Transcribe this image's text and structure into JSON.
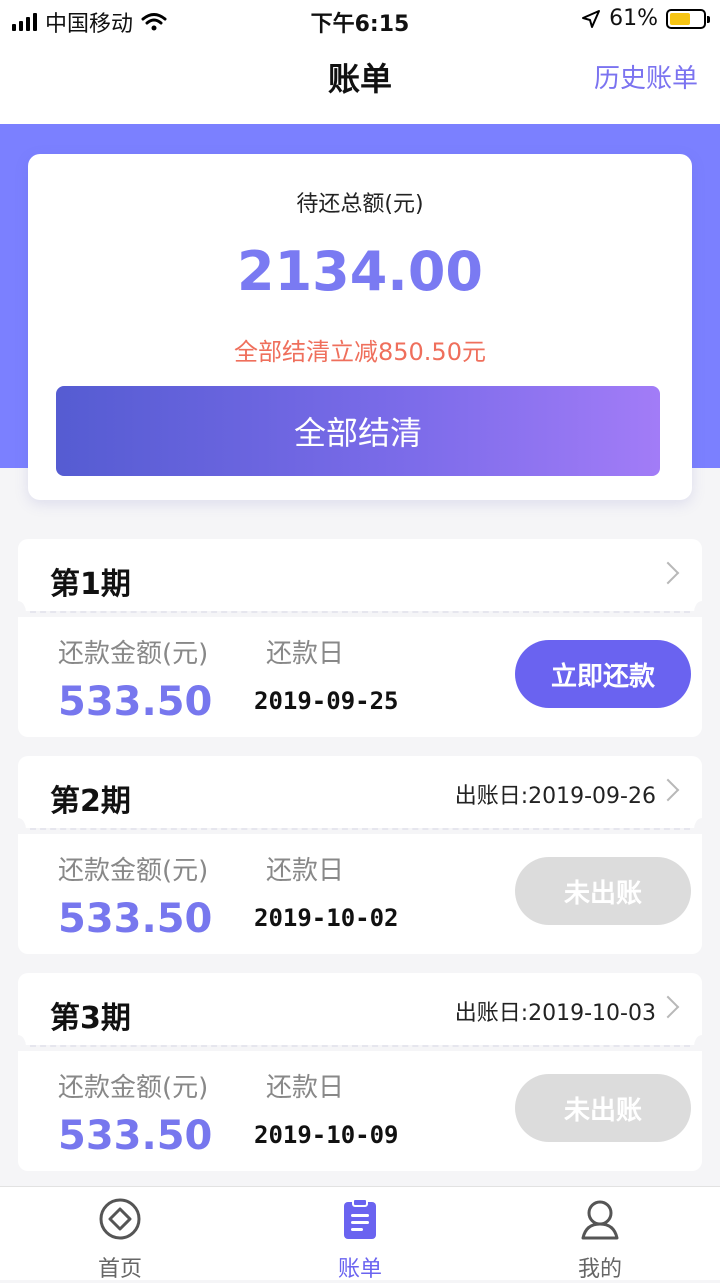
{
  "status_bar": {
    "carrier": "中国移动",
    "time": "下午6:15",
    "battery_percent": "61%",
    "battery_level": 0.61,
    "icons": [
      "signal-icon",
      "wifi-icon",
      "location-arrow-icon",
      "battery-icon"
    ]
  },
  "nav": {
    "title": "账单",
    "history_link": "历史账单"
  },
  "summary": {
    "label": "待还总额(元)",
    "amount": "2134.00",
    "discount_text": "全部结清立减850.50元",
    "settle_button": "全部结清"
  },
  "bills": [
    {
      "period": "第1期",
      "billing_date": "",
      "amount_label": "还款金额(元)",
      "due_label": "还款日",
      "amount": "533.50",
      "due_date": "2019-09-25",
      "button": "立即还款",
      "button_enabled": true
    },
    {
      "period": "第2期",
      "billing_date": "出账日:2019-09-26",
      "amount_label": "还款金额(元)",
      "due_label": "还款日",
      "amount": "533.50",
      "due_date": "2019-10-02",
      "button": "未出账",
      "button_enabled": false
    },
    {
      "period": "第3期",
      "billing_date": "出账日:2019-10-03",
      "amount_label": "还款金额(元)",
      "due_label": "还款日",
      "amount": "533.50",
      "due_date": "2019-10-09",
      "button": "未出账",
      "button_enabled": false
    }
  ],
  "tabbar": {
    "items": [
      {
        "label": "首页",
        "icon": "home-icon",
        "active": false
      },
      {
        "label": "账单",
        "icon": "bill-icon",
        "active": true
      },
      {
        "label": "我的",
        "icon": "profile-icon",
        "active": false
      }
    ]
  },
  "colors": {
    "accent": "#6a63f0",
    "banner": "#7b80ff",
    "discount": "#ef6f5c",
    "disabled_button": "#dcdcdc"
  }
}
